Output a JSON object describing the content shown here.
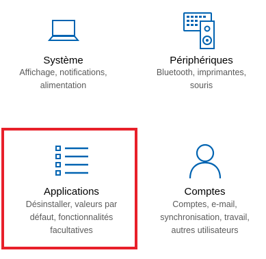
{
  "accent_color": "#0063b1",
  "highlight_color": "#e8202a",
  "tiles": [
    {
      "icon": "laptop-icon",
      "title": "Système",
      "description": [
        "Affichage, notifications,",
        "alimentation"
      ]
    },
    {
      "icon": "keyboard-speaker-icon",
      "title": "Périphériques",
      "description": [
        "Bluetooth, imprimantes,",
        "souris"
      ]
    },
    {
      "icon": "app-list-icon",
      "title": "Applications",
      "description": [
        "Désinstaller, valeurs par",
        "défaut, fonctionnalités",
        "facultatives"
      ],
      "highlighted": true
    },
    {
      "icon": "person-icon",
      "title": "Comptes",
      "description": [
        "Comptes, e-mail,",
        "synchronisation, travail,",
        "autres utilisateurs"
      ]
    }
  ]
}
